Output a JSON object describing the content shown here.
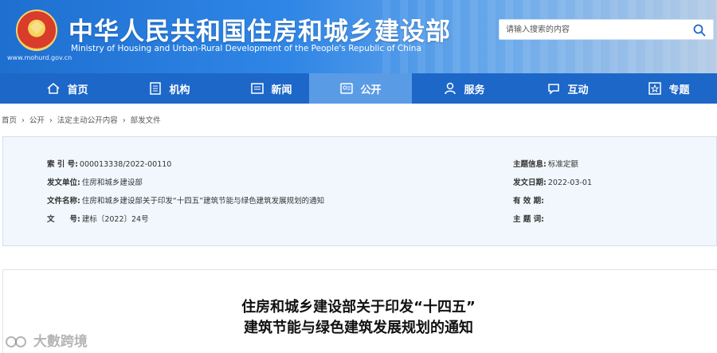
{
  "header": {
    "site_url": "www.mohurd.gov.cn",
    "title": "中华人民共和国住房和城乡建设部",
    "subtitle": "Ministry of Housing and Urban-Rural Development of the People's Republic of China"
  },
  "search": {
    "placeholder": "请输入搜索的内容",
    "icon": "search-icon"
  },
  "nav": {
    "items": [
      {
        "label": "首页",
        "icon": "home-icon"
      },
      {
        "label": "机构",
        "icon": "building-icon"
      },
      {
        "label": "新闻",
        "icon": "news-icon"
      },
      {
        "label": "公开",
        "icon": "open-icon",
        "active": true
      },
      {
        "label": "服务",
        "icon": "service-icon"
      },
      {
        "label": "互动",
        "icon": "interact-icon"
      },
      {
        "label": "专题",
        "icon": "topic-icon"
      }
    ]
  },
  "breadcrumb": [
    "首页",
    "›",
    "公开",
    "›",
    "法定主动公开内容",
    "›",
    "部发文件"
  ],
  "info": {
    "index_label": "索 引 号:",
    "index_value": "000013338/2022-00110",
    "issuer_label": "发文单位:",
    "issuer_value": "住房和城乡建设部",
    "filename_label": "文件名称:",
    "filename_value": "住房和城乡建设部关于印发“十四五”建筑节能与绿色建筑发展规划的通知",
    "docno_label": "文　　号:",
    "docno_value": "建标〔2022〕24号",
    "subject_label": "主题信息:",
    "subject_value": "标准定额",
    "date_label": "发文日期:",
    "date_value": "2022-03-01",
    "validity_label": "有 效 期:",
    "validity_value": "",
    "keywords_label": "主 题 词:",
    "keywords_value": ""
  },
  "article": {
    "title_line1": "住房和城乡建设部关于印发“十四五”",
    "title_line2": "建筑节能与绿色建筑发展规划的通知"
  },
  "watermark": {
    "text": "大數跨境"
  },
  "colors": {
    "nav": "#1d67c8",
    "nav_active": "#5a9be6",
    "panel_bg": "#f2f7fd"
  }
}
